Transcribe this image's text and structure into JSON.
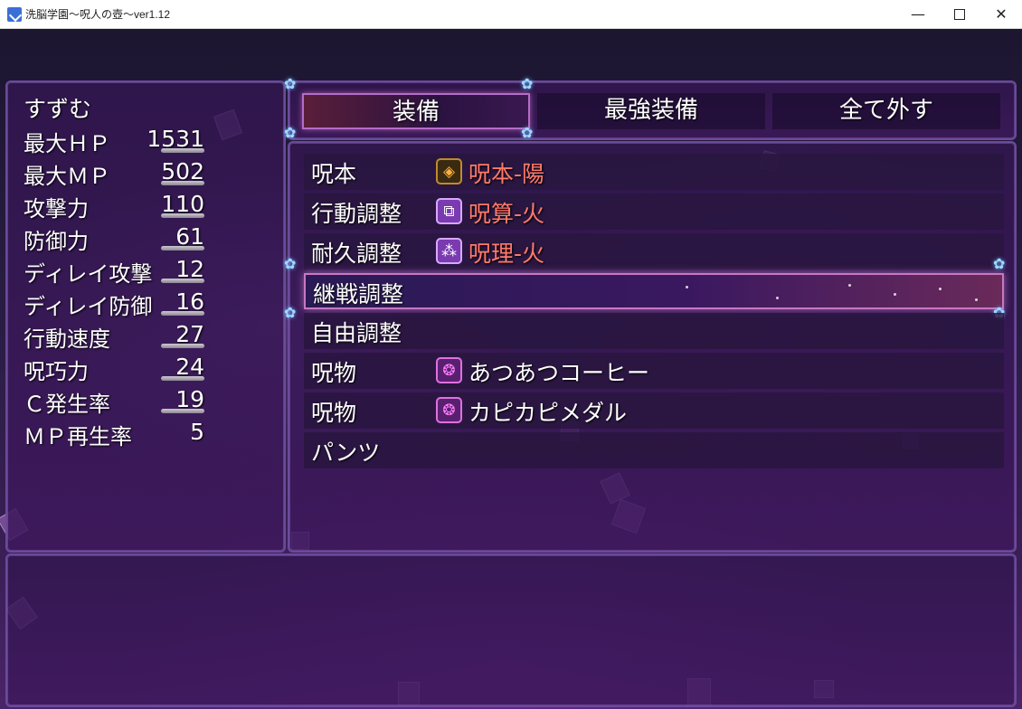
{
  "window": {
    "title": "洗脳学園～呪人の壺～ver1.12",
    "minimize_glyph": "—",
    "close_glyph": "✕"
  },
  "status": {
    "name": "すずむ",
    "stats": [
      {
        "label": "最大ＨＰ",
        "value": "1531"
      },
      {
        "label": "最大ＭＰ",
        "value": "502"
      },
      {
        "label": "攻撃力",
        "value": "110"
      },
      {
        "label": "防御力",
        "value": "61"
      },
      {
        "label": "ディレイ攻撃",
        "value": "12"
      },
      {
        "label": "ディレイ防御",
        "value": "16"
      },
      {
        "label": "行動速度",
        "value": "27"
      },
      {
        "label": "呪巧力",
        "value": "24"
      },
      {
        "label": "Ｃ発生率",
        "value": "19"
      },
      {
        "label": "ＭＰ再生率",
        "value": "5"
      }
    ]
  },
  "commands": [
    {
      "label": "装備",
      "selected": true
    },
    {
      "label": "最強装備",
      "selected": false
    },
    {
      "label": "全て外す",
      "selected": false
    }
  ],
  "slots": [
    {
      "label": "呪本",
      "icon": "book-icon",
      "item": "呪本-陽",
      "item_color": "#ff7a6a"
    },
    {
      "label": "行動調整",
      "icon": "square-puzzle-icon",
      "item": "呪算-火",
      "item_color": "#ff7a6a"
    },
    {
      "label": "耐久調整",
      "icon": "dice-icon",
      "item": "呪理-火",
      "item_color": "#ff7a6a"
    },
    {
      "label": "継戦調整",
      "icon": "",
      "item": "",
      "selected": true
    },
    {
      "label": "自由調整",
      "icon": "",
      "item": ""
    },
    {
      "label": "呪物",
      "icon": "brain-icon",
      "item": "あつあつコーヒー",
      "item_color": "#ffffff"
    },
    {
      "label": "呪物",
      "icon": "brain-icon",
      "item": "カピカピメダル",
      "item_color": "#ffffff"
    },
    {
      "label": "パンツ",
      "icon": "",
      "item": ""
    }
  ],
  "help_text": ""
}
